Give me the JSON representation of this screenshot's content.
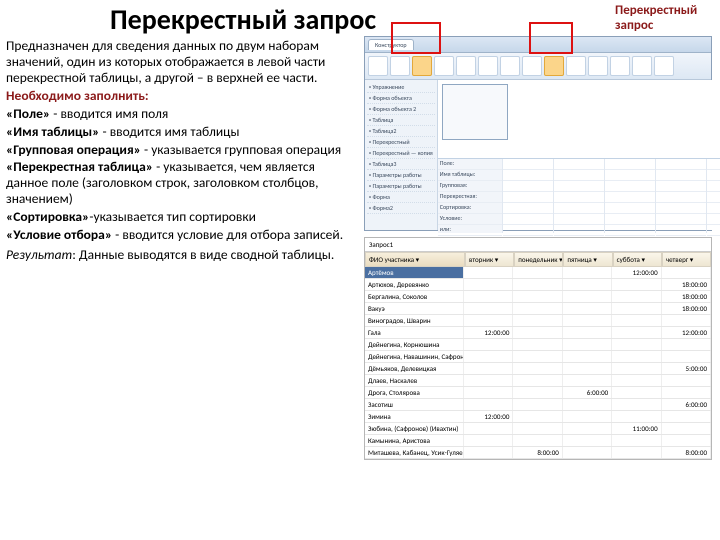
{
  "title": "Перекрестный запрос",
  "sidetag": "Перекрестный запрос",
  "para1": "Предназначен для сведения данных по двум наборам значений, один из которых отображается в левой части перекрестной таблицы, а другой – в верхней ее части.",
  "must_fill": "Необходимо заполнить:",
  "field_lbl": "«Поле»",
  "field_txt": " - вводится имя поля",
  "tname_lbl": "«Имя таблицы»",
  "tname_txt": " - вводится имя таблицы",
  "grp_lbl": "«Групповая операция»",
  "grp_txt": " - указывается групповая операция",
  "cross_lbl": "«Перекрестная таблица»",
  "cross_txt": " - указывается, чем является данное поле (заголовком строк, заголовком столбцов, значением)",
  "sort_lbl": "«Сортировка»",
  "sort_txt": "-указывается тип сортировки",
  "cond_lbl": "«Условие отбора»",
  "cond_txt": " - вводится условие для отбора записей.",
  "result_lbl": "Результат",
  "result_txt": ": Данные выводятся в виде сводной таблицы.",
  "nav_items": [
    "Упражнение",
    "Форма объекта",
    "Форма объекта 2",
    "Таблица",
    "Таблица2",
    "Перекрестный",
    "Перекрестный — копия",
    "Таблица3",
    "Параметры работы",
    "Параметры работы",
    "Форма",
    "Форма2"
  ],
  "grid_labels": [
    "Поле:",
    "Имя таблицы:",
    "Групповая:",
    "Перекрестная:",
    "Сортировка:",
    "Условие:",
    "или:"
  ],
  "tbl_header": "ФИО участника",
  "tbl_cols": [
    "вторник",
    "понедельник",
    "пятница",
    "суббота",
    "четверг"
  ],
  "rows": [
    {
      "n": "Артёмов",
      "v": [
        "",
        "",
        "",
        "12:00:00",
        ""
      ]
    },
    {
      "n": "Артюхов, Деревянко",
      "v": [
        "",
        "",
        "",
        "",
        "18:00:00"
      ]
    },
    {
      "n": "Бергалина, Соколов",
      "v": [
        "",
        "",
        "",
        "",
        "18:00:00"
      ]
    },
    {
      "n": "Вакуэ",
      "v": [
        "",
        "",
        "",
        "",
        "18:00:00"
      ]
    },
    {
      "n": "Виноградов, Шварин",
      "v": [
        "",
        "",
        "",
        "",
        ""
      ]
    },
    {
      "n": "Гала",
      "v": [
        "12:00:00",
        "",
        "",
        "",
        "12:00:00"
      ]
    },
    {
      "n": "Дейнегина, Корнюшина",
      "v": [
        "",
        "",
        "",
        "",
        ""
      ]
    },
    {
      "n": "Дейнегина, Навашинин, Сафронов",
      "v": [
        "",
        "",
        "",
        "",
        ""
      ]
    },
    {
      "n": "Дёмьяков, Делевицкая",
      "v": [
        "",
        "",
        "",
        "",
        "5:00:00"
      ]
    },
    {
      "n": "Длаев, Наскалев",
      "v": [
        "",
        "",
        "",
        "",
        ""
      ]
    },
    {
      "n": "Дрога, Столярова",
      "v": [
        "",
        "",
        "6:00:00",
        "",
        ""
      ]
    },
    {
      "n": "Засотиш",
      "v": [
        "",
        "",
        "",
        "",
        "6:00:00"
      ]
    },
    {
      "n": "Зимина",
      "v": [
        "12:00:00",
        "",
        "",
        "",
        ""
      ]
    },
    {
      "n": "Зюбина, (Сафронов) (Ивахтин)",
      "v": [
        "",
        "",
        "",
        "11:00:00",
        ""
      ]
    },
    {
      "n": "Камынина, Аристова",
      "v": [
        "",
        "",
        "",
        "",
        ""
      ]
    },
    {
      "n": "Миташева, Кабанец, Усик-Гуляе",
      "v": [
        "",
        "8:00:00",
        "",
        "",
        "8:00:00"
      ]
    }
  ]
}
